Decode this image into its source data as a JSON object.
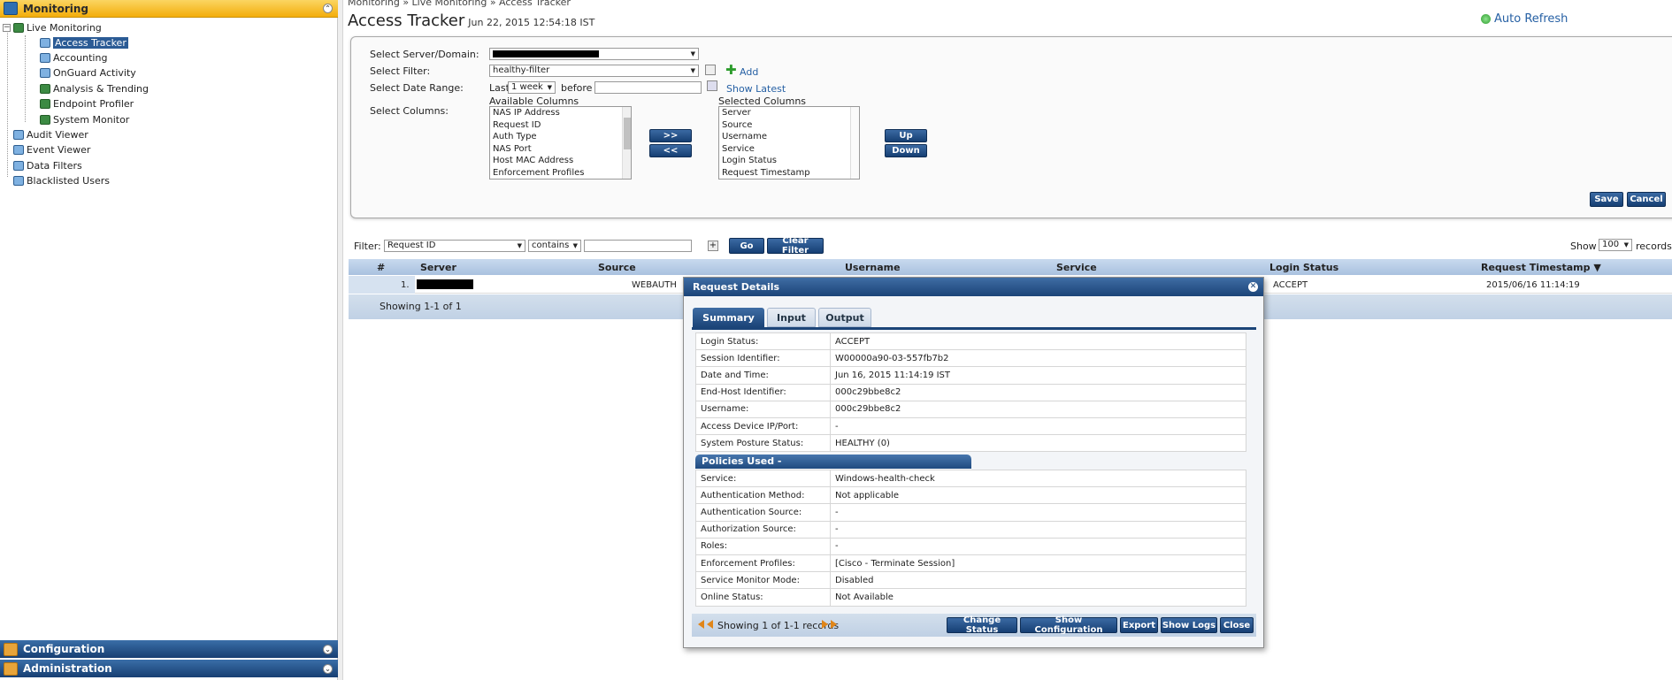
{
  "sidebar": {
    "monitoring_label": "Monitoring",
    "configuration_label": "Configuration",
    "administration_label": "Administration",
    "tree": {
      "live_monitoring": "Live Monitoring",
      "access_tracker": "Access Tracker",
      "accounting": "Accounting",
      "onguard_activity": "OnGuard Activity",
      "analysis_trending": "Analysis & Trending",
      "endpoint_profiler": "Endpoint Profiler",
      "system_monitor": "System Monitor",
      "audit_viewer": "Audit Viewer",
      "event_viewer": "Event Viewer",
      "data_filters": "Data Filters",
      "blacklisted_users": "Blacklisted Users"
    }
  },
  "header": {
    "breadcrumb": "Monitoring » Live Monitoring » Access Tracker",
    "title": "Access Tracker",
    "timestamp": "Jun 22, 2015 12:54:18 IST",
    "auto_refresh": "Auto Refresh"
  },
  "filter_panel": {
    "server_label": "Select Server/Domain:",
    "filter_label": "Select Filter:",
    "filter_value": "healthy-filter",
    "add_label": "Add",
    "date_range_label": "Select Date Range:",
    "last_label": "Last",
    "date_range_value": "1 week",
    "before_label": "before",
    "show_latest": "Show Latest",
    "columns_label": "Select Columns:",
    "available_heading": "Available Columns",
    "selected_heading": "Selected Columns",
    "available_columns": [
      "NAS IP Address",
      "Request ID",
      "Auth Type",
      "NAS Port",
      "Host MAC Address",
      "Enforcement Profiles"
    ],
    "selected_columns": [
      "Server",
      "Source",
      "Username",
      "Service",
      "Login Status",
      "Request Timestamp"
    ],
    "move_right": ">>",
    "move_left": "<<",
    "up": "Up",
    "down": "Down",
    "save": "Save",
    "cancel": "Cancel"
  },
  "filter_bar": {
    "label": "Filter:",
    "field": "Request ID",
    "operator": "contains",
    "go": "Go",
    "clear": "Clear Filter",
    "show_label": "Show",
    "page_size": "100",
    "records_label": "records"
  },
  "grid": {
    "columns": [
      "#",
      "Server",
      "Source",
      "Username",
      "Service",
      "Login Status",
      "Request Timestamp ▼"
    ],
    "row": {
      "num": "1.",
      "source": "WEBAUTH",
      "login_status": "ACCEPT",
      "timestamp": "2015/06/16 11:14:19"
    },
    "footer": "Showing 1-1 of 1"
  },
  "modal": {
    "title": "Request Details",
    "tabs": [
      "Summary",
      "Input",
      "Output"
    ],
    "summary": [
      {
        "k": "Login Status:",
        "v": "ACCEPT"
      },
      {
        "k": "Session Identifier:",
        "v": "W00000a90-03-557fb7b2"
      },
      {
        "k": "Date and Time:",
        "v": "Jun 16, 2015 11:14:19 IST"
      },
      {
        "k": "End-Host Identifier:",
        "v": "000c29bbe8c2"
      },
      {
        "k": "Username:",
        "v": "000c29bbe8c2"
      },
      {
        "k": "Access Device IP/Port:",
        "v": "-"
      },
      {
        "k": "System Posture Status:",
        "v": "HEALTHY (0)"
      }
    ],
    "policies_header": "Policies Used -",
    "policies": [
      {
        "k": "Service:",
        "v": "Windows-health-check"
      },
      {
        "k": "Authentication Method:",
        "v": "Not applicable"
      },
      {
        "k": "Authentication Source:",
        "v": "-"
      },
      {
        "k": "Authorization Source:",
        "v": "-"
      },
      {
        "k": "Roles:",
        "v": "-"
      },
      {
        "k": "Enforcement Profiles:",
        "v": "[Cisco - Terminate Session]"
      },
      {
        "k": "Service Monitor Mode:",
        "v": "Disabled"
      },
      {
        "k": "Online Status:",
        "v": "Not Available"
      }
    ],
    "footer_text": "Showing 1 of 1-1 records",
    "buttons": {
      "change_status": "Change Status",
      "show_configuration": "Show Configuration",
      "export": "Export",
      "show_logs": "Show Logs",
      "close": "Close"
    }
  }
}
